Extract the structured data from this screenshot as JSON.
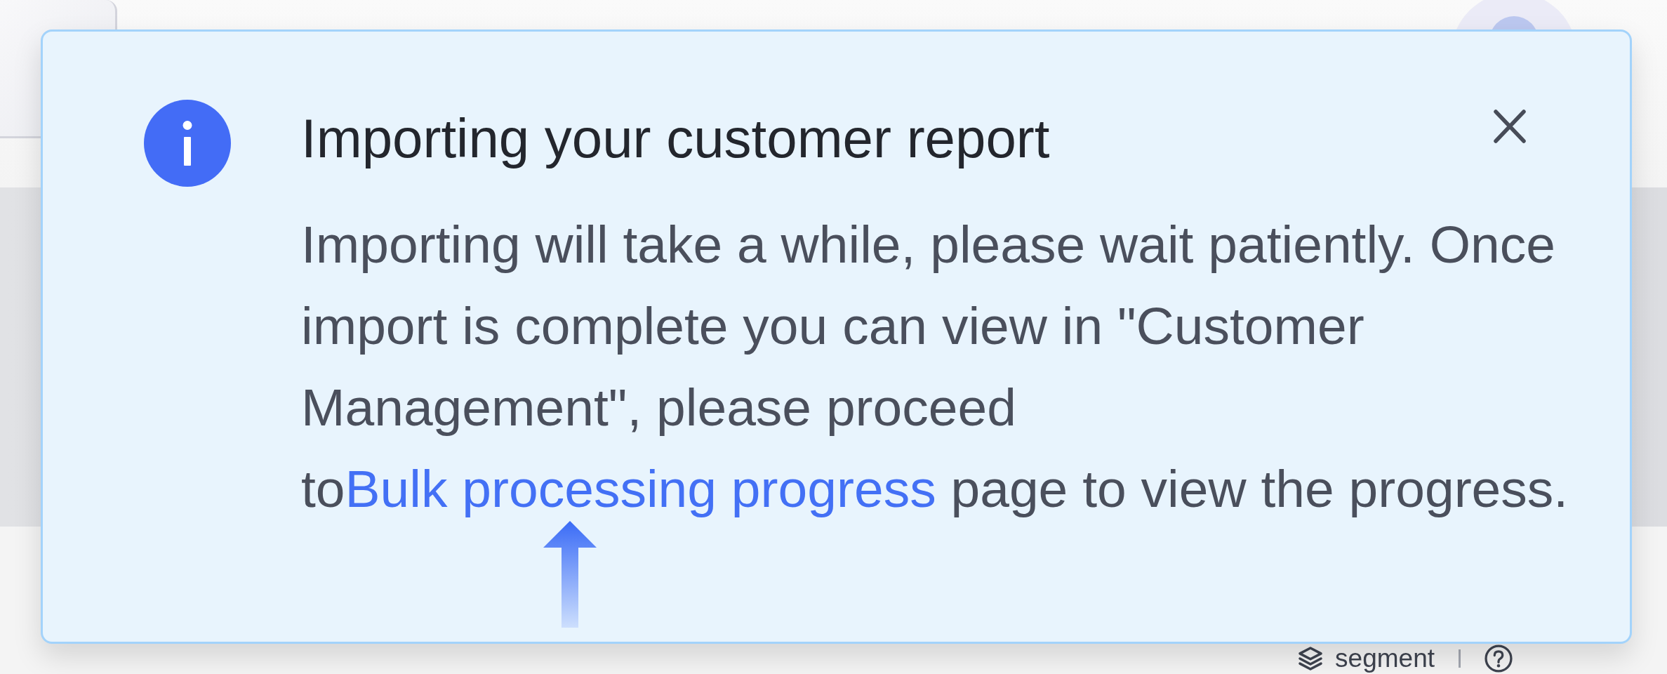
{
  "notification": {
    "title": "Importing your customer report",
    "message": {
      "text_before": "Importing will take a while, please wait patiently. Once import is complete you can view in \"Customer Management\", please proceed to",
      "link": "Bulk processing progress",
      "text_after": " page to view the progress."
    }
  },
  "toolbar": {
    "segment_button": {
      "label": "segment"
    }
  }
}
